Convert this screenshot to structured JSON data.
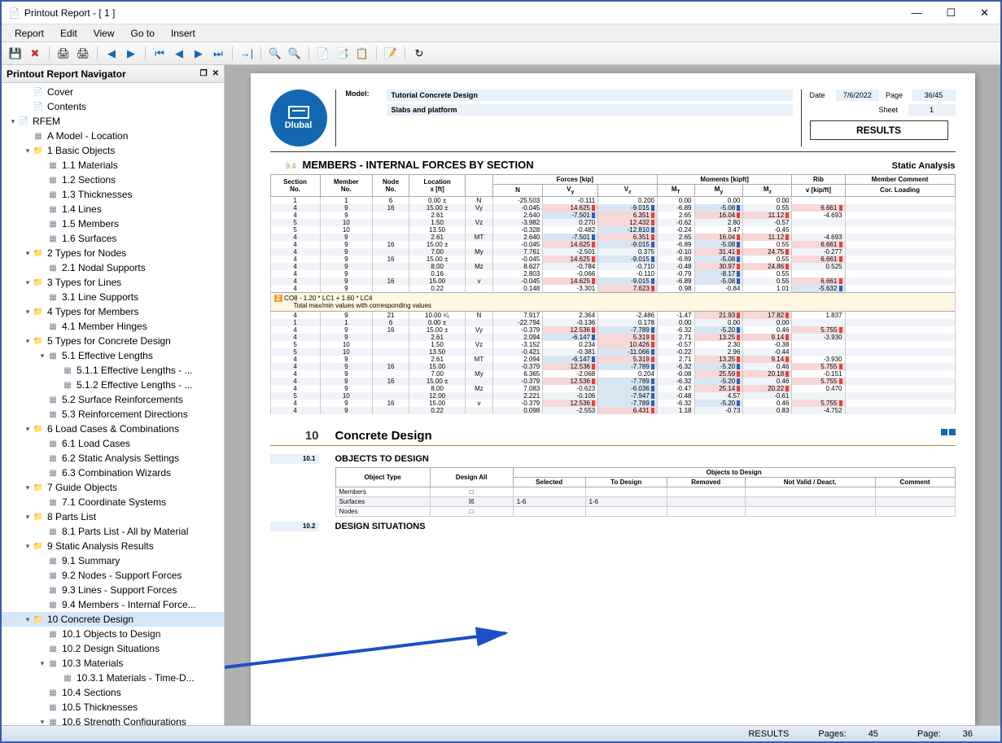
{
  "window": {
    "title": "Printout Report - [ 1 ]"
  },
  "menu": [
    "Report",
    "Edit",
    "View",
    "Go to",
    "Insert"
  ],
  "nav": {
    "title": "Printout Report Navigator",
    "items": [
      {
        "ind": 1,
        "exp": "",
        "icon": "page",
        "label": "Cover"
      },
      {
        "ind": 1,
        "exp": "",
        "icon": "page",
        "label": "Contents"
      },
      {
        "ind": 0,
        "exp": "▾",
        "icon": "page",
        "label": "RFEM"
      },
      {
        "ind": 1,
        "exp": "",
        "icon": "table",
        "label": "A Model - Location"
      },
      {
        "ind": 1,
        "exp": "▾",
        "icon": "folder",
        "label": "1 Basic Objects"
      },
      {
        "ind": 2,
        "exp": "",
        "icon": "table",
        "label": "1.1 Materials"
      },
      {
        "ind": 2,
        "exp": "",
        "icon": "table",
        "label": "1.2 Sections"
      },
      {
        "ind": 2,
        "exp": "",
        "icon": "table",
        "label": "1.3 Thicknesses"
      },
      {
        "ind": 2,
        "exp": "",
        "icon": "table",
        "label": "1.4 Lines"
      },
      {
        "ind": 2,
        "exp": "",
        "icon": "table",
        "label": "1.5 Members"
      },
      {
        "ind": 2,
        "exp": "",
        "icon": "table",
        "label": "1.6 Surfaces"
      },
      {
        "ind": 1,
        "exp": "▾",
        "icon": "folder",
        "label": "2 Types for Nodes"
      },
      {
        "ind": 2,
        "exp": "",
        "icon": "table",
        "label": "2.1 Nodal Supports"
      },
      {
        "ind": 1,
        "exp": "▾",
        "icon": "folder",
        "label": "3 Types for Lines"
      },
      {
        "ind": 2,
        "exp": "",
        "icon": "table",
        "label": "3.1 Line Supports"
      },
      {
        "ind": 1,
        "exp": "▾",
        "icon": "folder",
        "label": "4 Types for Members"
      },
      {
        "ind": 2,
        "exp": "",
        "icon": "table",
        "label": "4.1 Member Hinges"
      },
      {
        "ind": 1,
        "exp": "▾",
        "icon": "folder",
        "label": "5 Types for Concrete Design"
      },
      {
        "ind": 2,
        "exp": "▾",
        "icon": "table",
        "label": "5.1 Effective Lengths"
      },
      {
        "ind": 3,
        "exp": "",
        "icon": "table",
        "label": "5.1.1 Effective Lengths - ..."
      },
      {
        "ind": 3,
        "exp": "",
        "icon": "table",
        "label": "5.1.2 Effective Lengths - ..."
      },
      {
        "ind": 2,
        "exp": "",
        "icon": "table",
        "label": "5.2 Surface Reinforcements"
      },
      {
        "ind": 2,
        "exp": "",
        "icon": "table",
        "label": "5.3 Reinforcement Directions"
      },
      {
        "ind": 1,
        "exp": "▾",
        "icon": "folder",
        "label": "6 Load Cases & Combinations"
      },
      {
        "ind": 2,
        "exp": "",
        "icon": "table",
        "label": "6.1 Load Cases"
      },
      {
        "ind": 2,
        "exp": "",
        "icon": "table",
        "label": "6.2 Static Analysis Settings"
      },
      {
        "ind": 2,
        "exp": "",
        "icon": "table",
        "label": "6.3 Combination Wizards"
      },
      {
        "ind": 1,
        "exp": "▾",
        "icon": "folder",
        "label": "7 Guide Objects"
      },
      {
        "ind": 2,
        "exp": "",
        "icon": "table",
        "label": "7.1 Coordinate Systems"
      },
      {
        "ind": 1,
        "exp": "▾",
        "icon": "folder",
        "label": "8 Parts List"
      },
      {
        "ind": 2,
        "exp": "",
        "icon": "table",
        "label": "8.1 Parts List - All by Material"
      },
      {
        "ind": 1,
        "exp": "▾",
        "icon": "folder",
        "label": "9 Static Analysis Results"
      },
      {
        "ind": 2,
        "exp": "",
        "icon": "table",
        "label": "9.1 Summary"
      },
      {
        "ind": 2,
        "exp": "",
        "icon": "table",
        "label": "9.2 Nodes - Support Forces"
      },
      {
        "ind": 2,
        "exp": "",
        "icon": "table",
        "label": "9.3 Lines - Support Forces"
      },
      {
        "ind": 2,
        "exp": "",
        "icon": "table",
        "label": "9.4 Members - Internal Force..."
      },
      {
        "ind": 1,
        "exp": "▾",
        "icon": "folder",
        "label": "10 Concrete Design",
        "sel": true
      },
      {
        "ind": 2,
        "exp": "",
        "icon": "table",
        "label": "10.1 Objects to Design"
      },
      {
        "ind": 2,
        "exp": "",
        "icon": "table",
        "label": "10.2 Design Situations"
      },
      {
        "ind": 2,
        "exp": "▾",
        "icon": "table",
        "label": "10.3 Materials"
      },
      {
        "ind": 3,
        "exp": "",
        "icon": "table",
        "label": "10.3.1 Materials - Time-D..."
      },
      {
        "ind": 2,
        "exp": "",
        "icon": "table",
        "label": "10.4 Sections"
      },
      {
        "ind": 2,
        "exp": "",
        "icon": "table",
        "label": "10.5 Thicknesses"
      },
      {
        "ind": 2,
        "exp": "▾",
        "icon": "table",
        "label": "10.6 Strength Configurations"
      }
    ]
  },
  "page": {
    "model_lbl": "Model:",
    "model": "Tutorial Concrete Design",
    "sub": "Slabs and platform",
    "date_lbl": "Date",
    "date": "7/6/2022",
    "page_lbl": "Page",
    "page": "36/45",
    "sheet_lbl": "Sheet",
    "sheet": "1",
    "results": "RESULTS",
    "logo": "Dlubal"
  },
  "section94": {
    "num": "9.4",
    "title": "MEMBERS - INTERNAL FORCES BY SECTION",
    "right": "Static Analysis",
    "cols_top": {
      "forces": "Forces [kip]",
      "moments": "Moments [kipft]",
      "rib": "Rib",
      "comment": "Member Comment"
    },
    "cols": [
      "Section No.",
      "Member No.",
      "Node No.",
      "Location x [ft]",
      "",
      "N",
      "Vy",
      "Vz",
      "MT",
      "My",
      "Mz",
      "v [kip/ft]",
      "Cor. Loading"
    ],
    "rows1": [
      [
        "1",
        "1",
        "6",
        "0.00 ±",
        "N",
        "-25.503",
        "-0.111",
        "0.200",
        "0.00",
        "0.00",
        "0.00",
        "",
        ""
      ],
      [
        "4",
        "9",
        "16",
        "15.00 ±",
        "Vy",
        "-0.045",
        "14.625",
        "-9.015",
        "-6.89",
        "-5.08",
        "0.55",
        "6.661",
        ""
      ],
      [
        "4",
        "9",
        "",
        "2.61",
        "",
        "2.640",
        "-7.501",
        "6.351",
        "2.65",
        "16.04",
        "11.12",
        "-4.693",
        ""
      ],
      [
        "5",
        "10",
        "",
        "1.50",
        "Vz",
        "-3.982",
        "0.270",
        "12.432",
        "-0.62",
        "2.80",
        "-0.57",
        "",
        ""
      ],
      [
        "5",
        "10",
        "",
        "13.50",
        "",
        "-0.328",
        "-0.482",
        "-12.810",
        "-0.24",
        "3.47",
        "-0.45",
        "",
        ""
      ],
      [
        "4",
        "9",
        "",
        "2.61",
        "MT",
        "2.640",
        "-7.501",
        "6.351",
        "2.65",
        "16.04",
        "11.12",
        "-4.693",
        ""
      ],
      [
        "4",
        "9",
        "16",
        "15.00 ±",
        "",
        "-0.045",
        "14.625",
        "-9.015",
        "-6.89",
        "-5.08",
        "0.55",
        "6.661",
        ""
      ],
      [
        "4",
        "9",
        "",
        "7.00",
        "My",
        "7.761",
        "-2.501",
        "0.375",
        "-0.10",
        "31.41",
        "24.75",
        "-0.277",
        ""
      ],
      [
        "4",
        "9",
        "16",
        "15.00 ±",
        "",
        "-0.045",
        "14.625",
        "-9.015",
        "-6.89",
        "-5.08",
        "0.55",
        "6.661",
        ""
      ],
      [
        "4",
        "9",
        "",
        "8.00",
        "Mz",
        "8.627",
        "-0.784",
        "-0.710",
        "-0.48",
        "30.97",
        "24.86",
        "0.525",
        ""
      ],
      [
        "4",
        "9",
        "",
        "0.16",
        "",
        "2.803",
        "-0.066",
        "-0.110",
        "-0.79",
        "-8.17",
        "0.55",
        "",
        ""
      ],
      [
        "4",
        "9",
        "16",
        "15.00",
        "v",
        "-0.045",
        "14.625",
        "-9.015",
        "-6.89",
        "-5.08",
        "0.55",
        "6.661",
        ""
      ],
      [
        "4",
        "9",
        "",
        "0.22",
        "",
        "0.148",
        "-3.301",
        "7.623",
        "0.98",
        "-0.84",
        "1.01",
        "-5.632",
        ""
      ]
    ],
    "group": "CO8 - 1.20 * LC1 + 1.60 * LC4",
    "group_sub": "Total max/min values with corresponding values",
    "rows2": [
      [
        "4",
        "9",
        "21",
        "10.00 ⁵⁄₆",
        "N",
        "7.917",
        "2.364",
        "-2.486",
        "-1.47",
        "21.93",
        "17.82",
        "1.837",
        ""
      ],
      [
        "1",
        "1",
        "6",
        "0.00 ±",
        "",
        "-22.794",
        "-0.136",
        "0.178",
        "0.00",
        "0.00",
        "0.00",
        "",
        ""
      ],
      [
        "4",
        "9",
        "16",
        "15.00 ±",
        "Vy",
        "-0.379",
        "12.536",
        "-7.789",
        "-6.32",
        "-5.20",
        "0.46",
        "5.755",
        ""
      ],
      [
        "4",
        "9",
        "",
        "2.61",
        "",
        "2.094",
        "-6.147",
        "5.319",
        "2.71",
        "13.25",
        "9.14",
        "-3.930",
        ""
      ],
      [
        "5",
        "10",
        "",
        "1.50",
        "Vz",
        "-3.152",
        "0.234",
        "10.426",
        "-0.57",
        "2.30",
        "-0.38",
        "",
        ""
      ],
      [
        "5",
        "10",
        "",
        "13.50",
        "",
        "-0.421",
        "-0.381",
        "-11.066",
        "-0.22",
        "2.96",
        "-0.44",
        "",
        ""
      ],
      [
        "4",
        "9",
        "",
        "2.61",
        "MT",
        "2.094",
        "-6.147",
        "5.319",
        "2.71",
        "13.25",
        "9.14",
        "-3.930",
        ""
      ],
      [
        "4",
        "9",
        "16",
        "15.00",
        "",
        "-0.379",
        "12.536",
        "-7.789",
        "-6.32",
        "-5.20",
        "0.46",
        "5.755",
        ""
      ],
      [
        "4",
        "9",
        "",
        "7.00",
        "My",
        "6.365",
        "-2.068",
        "0.204",
        "-0.08",
        "25.59",
        "20.18",
        "-0.151",
        ""
      ],
      [
        "4",
        "9",
        "16",
        "15.00 ±",
        "",
        "-0.379",
        "12.536",
        "-7.789",
        "-6.32",
        "-5.20",
        "0.46",
        "5.755",
        ""
      ],
      [
        "4",
        "9",
        "",
        "8.00",
        "Mz",
        "7.083",
        "-0.623",
        "-6.036",
        "-0.47",
        "25.14",
        "20.22",
        "0.470",
        ""
      ],
      [
        "5",
        "10",
        "",
        "12.00",
        "",
        "2.221",
        "-0.106",
        "-7.947",
        "-0.48",
        "4.57",
        "-0.61",
        "",
        ""
      ],
      [
        "4",
        "9",
        "16",
        "15.00",
        "v",
        "-0.379",
        "12.536",
        "-7.789",
        "-6.32",
        "-5.20",
        "0.46",
        "5.755",
        ""
      ],
      [
        "4",
        "9",
        "",
        "0.22",
        "",
        "0.098",
        "-2.553",
        "6.431",
        "1.18",
        "-0.73",
        "0.83",
        "-4.752",
        ""
      ]
    ]
  },
  "section10": {
    "num": "10",
    "title": "Concrete Design"
  },
  "section101": {
    "num": "10.1",
    "title": "OBJECTS TO DESIGN",
    "hdr1": "Object Type",
    "hdr2": "Design All",
    "hdr_group": "Objects to Design",
    "cols": [
      "Selected",
      "To Design",
      "Removed",
      "Not Valid / Deact.",
      "Comment"
    ],
    "rows": [
      {
        "type": "Members",
        "check": "□",
        "selected": "",
        "toDesign": "",
        "removed": "",
        "nvd": "",
        "cmt": ""
      },
      {
        "type": "Surfaces",
        "check": "☒",
        "selected": "1-6",
        "toDesign": "1-6",
        "removed": "",
        "nvd": "",
        "cmt": ""
      },
      {
        "type": "Nodes",
        "check": "□",
        "selected": "",
        "toDesign": "",
        "removed": "",
        "nvd": "",
        "cmt": ""
      }
    ]
  },
  "section102": {
    "num": "10.2",
    "title": "DESIGN SITUATIONS"
  },
  "status": {
    "results": "RESULTS",
    "pages_lbl": "Pages:",
    "pages": "45",
    "page_lbl": "Page:",
    "page": "36"
  }
}
